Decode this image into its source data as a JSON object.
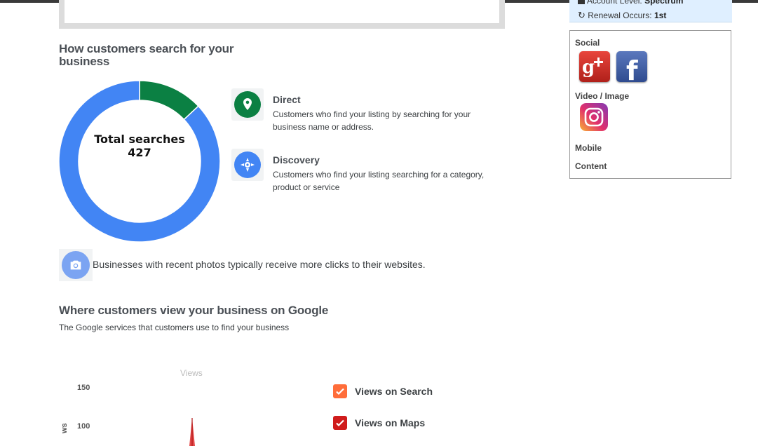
{
  "search_section": {
    "title": "How customers search for your business",
    "total_label": "Total searches",
    "total_value": "427",
    "legend": [
      {
        "name": "Direct",
        "description": "Customers who find your listing by searching for your business name or address.",
        "color": "#0b8043"
      },
      {
        "name": "Discovery",
        "description": "Customers who find your listing searching for a category, product or service",
        "color": "#4285f4"
      }
    ],
    "photo_tip": "Businesses with recent photos typically receive more clicks to their websites."
  },
  "chart_data": {
    "type": "pie",
    "title": "",
    "slices": [
      {
        "label": "Direct",
        "fraction": 0.13,
        "color": "#0b8043"
      },
      {
        "label": "Discovery",
        "fraction": 0.87,
        "color": "#4285f4"
      }
    ],
    "total": 427
  },
  "views_section": {
    "title": "Where customers view your business on Google",
    "subtitle": "The Google services that customers use to find your business",
    "chart_title": "Views",
    "y_axis_label": "ws",
    "y_ticks": [
      "150",
      "100"
    ],
    "series": [
      {
        "label": "Views on Search",
        "color": "#ff6d3a",
        "checked": true
      },
      {
        "label": "Views on Maps",
        "color": "#d01c1c",
        "checked": true
      }
    ]
  },
  "account": {
    "level_label": "Account Level:",
    "level_value": "Spectrum",
    "renewal_label": "Renewal Occurs:",
    "renewal_value": "1st"
  },
  "sidebar": {
    "social_label": "Social",
    "video_label": "Video / Image",
    "mobile_label": "Mobile",
    "content_label": "Content",
    "icons": [
      "google-plus-icon",
      "facebook-icon",
      "instagram-icon"
    ]
  }
}
